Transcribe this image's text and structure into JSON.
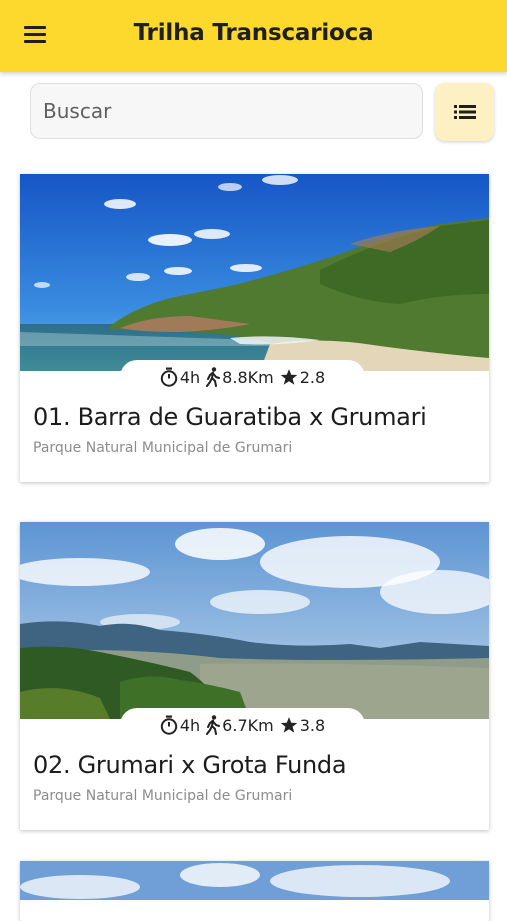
{
  "app_bar": {
    "title": "Trilha Transcarioca",
    "menu_icon": "hamburger-menu-icon"
  },
  "search": {
    "placeholder": "Buscar",
    "value": ""
  },
  "view_toggle": {
    "icon": "list-view-icon"
  },
  "colors": {
    "app_bar": "#fdd92e",
    "list_button": "#fdf1c4",
    "subtitle": "#8c8c8c"
  },
  "trails": [
    {
      "title": "01. Barra de Guaratiba x Grumari",
      "park": "Parque Natural Municipal de Grumari",
      "duration": "4h",
      "distance": "8.8Km",
      "rating": "2.8",
      "image": "coastline-beach-photo"
    },
    {
      "title": "02. Grumari x Grota Funda",
      "park": "Parque Natural Municipal de Grumari",
      "duration": "4h",
      "distance": "6.7Km",
      "rating": "3.8",
      "image": "mountain-panorama-photo"
    },
    {
      "image": "sky-clouds-photo"
    }
  ]
}
